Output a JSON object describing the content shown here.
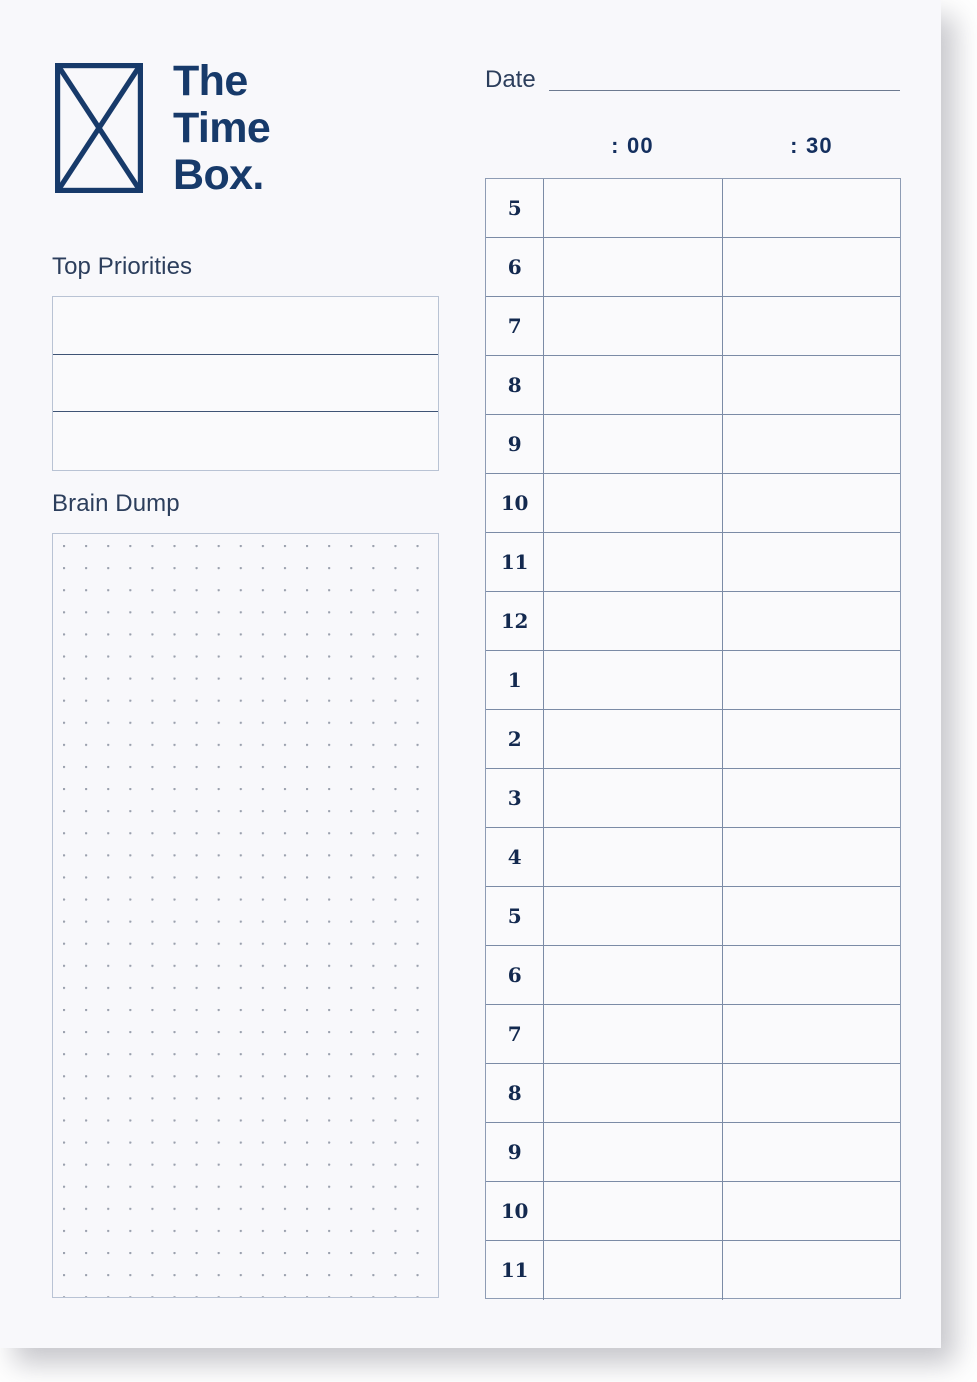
{
  "page": {
    "background_color": "#ffffff",
    "card_color": "#f8f8fb",
    "ink_color": "#13294f",
    "rule_color": "#7b8ba6"
  },
  "logo": {
    "mark": "hourglass-box-icon",
    "wordmark_lines": [
      "The",
      "Time",
      "Box."
    ]
  },
  "sections": {
    "top_priorities": {
      "heading": "Top Priorities",
      "rows": [
        "",
        "",
        ""
      ]
    },
    "brain_dump": {
      "heading": "Brain Dump",
      "content": "",
      "grid_style": "dot-grid"
    }
  },
  "date_field": {
    "label": "Date",
    "value": ""
  },
  "schedule": {
    "column_headers": [
      ": 00",
      ": 30"
    ],
    "rows": [
      {
        "hour": "5",
        "slot_00": "",
        "slot_30": ""
      },
      {
        "hour": "6",
        "slot_00": "",
        "slot_30": ""
      },
      {
        "hour": "7",
        "slot_00": "",
        "slot_30": ""
      },
      {
        "hour": "8",
        "slot_00": "",
        "slot_30": ""
      },
      {
        "hour": "9",
        "slot_00": "",
        "slot_30": ""
      },
      {
        "hour": "10",
        "slot_00": "",
        "slot_30": ""
      },
      {
        "hour": "11",
        "slot_00": "",
        "slot_30": ""
      },
      {
        "hour": "12",
        "slot_00": "",
        "slot_30": ""
      },
      {
        "hour": "1",
        "slot_00": "",
        "slot_30": ""
      },
      {
        "hour": "2",
        "slot_00": "",
        "slot_30": ""
      },
      {
        "hour": "3",
        "slot_00": "",
        "slot_30": ""
      },
      {
        "hour": "4",
        "slot_00": "",
        "slot_30": ""
      },
      {
        "hour": "5",
        "slot_00": "",
        "slot_30": ""
      },
      {
        "hour": "6",
        "slot_00": "",
        "slot_30": ""
      },
      {
        "hour": "7",
        "slot_00": "",
        "slot_30": ""
      },
      {
        "hour": "8",
        "slot_00": "",
        "slot_30": ""
      },
      {
        "hour": "9",
        "slot_00": "",
        "slot_30": ""
      },
      {
        "hour": "10",
        "slot_00": "",
        "slot_30": ""
      },
      {
        "hour": "11",
        "slot_00": "",
        "slot_30": ""
      }
    ]
  }
}
